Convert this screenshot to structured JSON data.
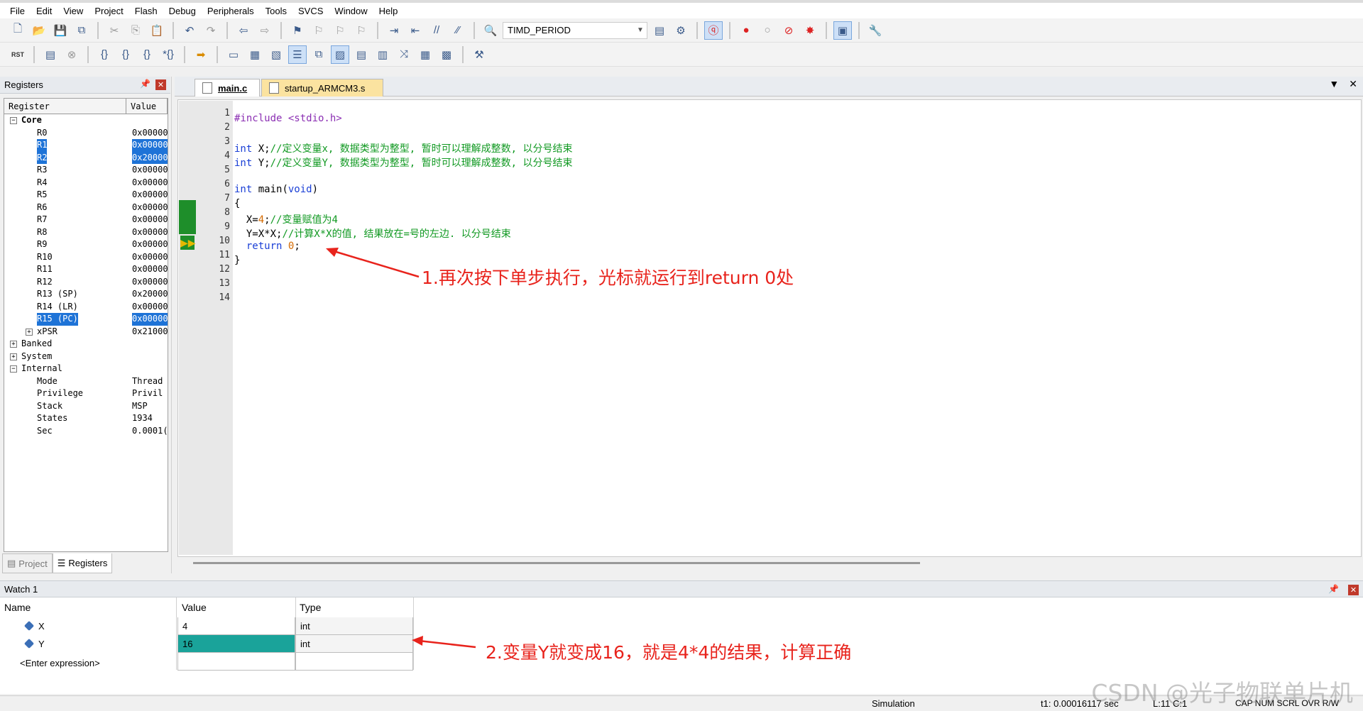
{
  "menu": [
    "File",
    "Edit",
    "View",
    "Project",
    "Flash",
    "Debug",
    "Peripherals",
    "Tools",
    "SVCS",
    "Window",
    "Help"
  ],
  "toolbar": {
    "target": "TIMD_PERIOD",
    "reset_label": "RST"
  },
  "registers_panel": {
    "title": "Registers",
    "col_register": "Register",
    "col_value": "Value",
    "core_label": "Core",
    "rows": [
      {
        "name": "R0",
        "value": "0x00000",
        "selected": false
      },
      {
        "name": "R1",
        "value": "0x00000",
        "selected": true
      },
      {
        "name": "R2",
        "value": "0x20000",
        "selected": true
      },
      {
        "name": "R3",
        "value": "0x00000",
        "selected": false
      },
      {
        "name": "R4",
        "value": "0x00000",
        "selected": false
      },
      {
        "name": "R5",
        "value": "0x00000",
        "selected": false
      },
      {
        "name": "R6",
        "value": "0x00000",
        "selected": false
      },
      {
        "name": "R7",
        "value": "0x00000",
        "selected": false
      },
      {
        "name": "R8",
        "value": "0x00000",
        "selected": false
      },
      {
        "name": "R9",
        "value": "0x00000",
        "selected": false
      },
      {
        "name": "R10",
        "value": "0x00000",
        "selected": false
      },
      {
        "name": "R11",
        "value": "0x00000",
        "selected": false
      },
      {
        "name": "R12",
        "value": "0x00000",
        "selected": false
      },
      {
        "name": "R13 (SP)",
        "value": "0x20000",
        "selected": false
      },
      {
        "name": "R14 (LR)",
        "value": "0x00000",
        "selected": false
      },
      {
        "name": "R15 (PC)",
        "value": "0x00000",
        "selected": true
      },
      {
        "name": "xPSR",
        "value": "0x21000",
        "selected": false
      }
    ],
    "groups": [
      "Banked",
      "System",
      "Internal"
    ],
    "internal": [
      {
        "name": "Mode",
        "value": "Thread"
      },
      {
        "name": "Privilege",
        "value": "Privil"
      },
      {
        "name": "Stack",
        "value": "MSP"
      },
      {
        "name": "States",
        "value": "1934"
      },
      {
        "name": "Sec",
        "value": "0.0001("
      }
    ],
    "tabs": [
      "Project",
      "Registers"
    ]
  },
  "editor": {
    "tabs": [
      "main.c",
      "startup_ARMCM3.s"
    ],
    "line_numbers": [
      "1",
      "2",
      "3",
      "4",
      "5",
      "6",
      "7",
      "8",
      "9",
      "10",
      "11",
      "12",
      "13",
      "14"
    ],
    "code": {
      "l2": "#include <stdio.h>",
      "l4_kw": "int",
      "l4_var": " X;",
      "l4_cm": "//定义变量x, 数据类型为整型, 暂时可以理解成整数, 以分号结束",
      "l5_kw": "int",
      "l5_var": " Y;",
      "l5_cm": "//定义变量Y, 数据类型为整型, 暂时可以理解成整数, 以分号结束",
      "l7_kw": "int",
      "l7_fn": " main(",
      "l7_kw2": "void",
      "l7_end": ")",
      "l8": "{",
      "l9_a": "  X=",
      "l9_num": "4",
      "l9_b": ";",
      "l9_cm": "//变量赋值为4",
      "l10_a": "  Y=X*X;",
      "l10_cm": "//计算X*X的值, 结果放在=号的左边. 以分号结束",
      "l11_kw": "  return",
      "l11_sp": " ",
      "l11_num": "0",
      "l11_end": ";",
      "l12": "}"
    }
  },
  "annotations": {
    "a1": "1.再次按下单步执行，光标就运行到return 0处",
    "a2": "2.变量Y就变成16，就是4*4的结果，计算正确"
  },
  "watch": {
    "title": "Watch 1",
    "col_name": "Name",
    "col_value": "Value",
    "col_type": "Type",
    "rows": [
      {
        "name": "X",
        "value": "4",
        "type": "int"
      },
      {
        "name": "Y",
        "value": "16",
        "type": "int"
      }
    ],
    "enter_expression": "<Enter expression>"
  },
  "status": {
    "mode": "Simulation",
    "time": "t1: 0.00016117 sec",
    "position": "L:11 C:1",
    "indicators": "CAP  NUM  SCRL  OVR  R/W"
  },
  "watermark": "CSDN @光子物联单片机",
  "colors": {
    "selection": "#1e73d7",
    "watch_changed": "#1aa39a",
    "annotation": "#e8231c",
    "breakpoint_bar": "#1e8e2a"
  }
}
